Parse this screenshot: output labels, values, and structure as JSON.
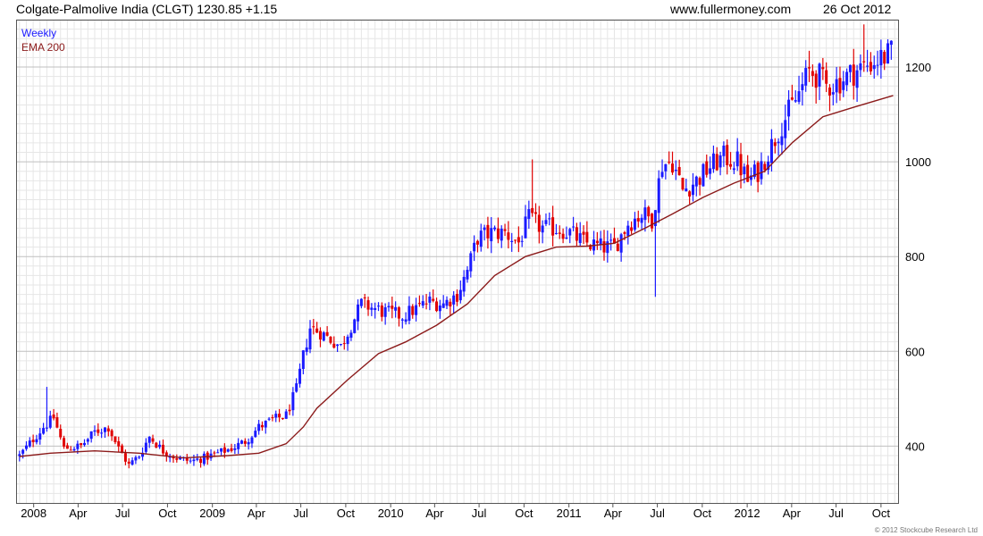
{
  "header": {
    "instrument": "Colgate-Palmolive India (CLGT) 1230.85 +1.15",
    "site": "www.fullermoney.com",
    "date": "26 Oct 2012"
  },
  "copyright": "© 2012 Stockcube Research Ltd",
  "colors": {
    "up": "#1a1aff",
    "down": "#e00000",
    "ema": "#8b1a1a",
    "grid": "#e6e6e6",
    "grid_major": "#bfbfbf",
    "axis": "#555555"
  },
  "chart_data": {
    "type": "candlestick",
    "frequency": "weekly",
    "legend": [
      {
        "label": "Weekly",
        "color": "#1a1aff"
      },
      {
        "label": "EMA 200",
        "color": "#8b1a1a"
      }
    ],
    "legend_position": "top-left",
    "y_axis": {
      "position": "right",
      "range": [
        280,
        1300
      ],
      "ticks": [
        400,
        600,
        800,
        1000,
        1200
      ]
    },
    "x_axis": {
      "range": [
        "2007-11-26",
        "2012-11-05"
      ],
      "ticks": [
        {
          "label": "2008",
          "date": "2008-01-01"
        },
        {
          "label": "Apr",
          "date": "2008-04-01"
        },
        {
          "label": "Jul",
          "date": "2008-07-01"
        },
        {
          "label": "Oct",
          "date": "2008-10-01"
        },
        {
          "label": "2009",
          "date": "2009-01-01"
        },
        {
          "label": "Apr",
          "date": "2009-04-01"
        },
        {
          "label": "Jul",
          "date": "2009-07-01"
        },
        {
          "label": "Oct",
          "date": "2009-10-01"
        },
        {
          "label": "2010",
          "date": "2010-01-01"
        },
        {
          "label": "Apr",
          "date": "2010-04-01"
        },
        {
          "label": "Jul",
          "date": "2010-07-01"
        },
        {
          "label": "Oct",
          "date": "2010-10-01"
        },
        {
          "label": "2011",
          "date": "2011-01-01"
        },
        {
          "label": "Apr",
          "date": "2011-04-01"
        },
        {
          "label": "Jul",
          "date": "2011-07-01"
        },
        {
          "label": "Oct",
          "date": "2011-10-01"
        },
        {
          "label": "2012",
          "date": "2012-01-01"
        },
        {
          "label": "Apr",
          "date": "2012-04-01"
        },
        {
          "label": "Jul",
          "date": "2012-07-01"
        },
        {
          "label": "Oct",
          "date": "2012-10-01"
        }
      ]
    },
    "grid": true,
    "price_path": [
      [
        "2007-12-03",
        380
      ],
      [
        "2008-01-21",
        440
      ],
      [
        "2008-02-11",
        460
      ],
      [
        "2008-03-03",
        395
      ],
      [
        "2008-04-07",
        400
      ],
      [
        "2008-05-05",
        430
      ],
      [
        "2008-06-02",
        440
      ],
      [
        "2008-06-23",
        395
      ],
      [
        "2008-07-14",
        360
      ],
      [
        "2008-08-04",
        380
      ],
      [
        "2008-08-25",
        420
      ],
      [
        "2008-09-22",
        390
      ],
      [
        "2008-10-20",
        375
      ],
      [
        "2008-11-17",
        368
      ],
      [
        "2008-12-15",
        375
      ],
      [
        "2009-01-12",
        385
      ],
      [
        "2009-02-09",
        395
      ],
      [
        "2009-03-09",
        410
      ],
      [
        "2009-04-06",
        440
      ],
      [
        "2009-05-04",
        455
      ],
      [
        "2009-06-01",
        465
      ],
      [
        "2009-06-22",
        520
      ],
      [
        "2009-07-06",
        590
      ],
      [
        "2009-07-20",
        650
      ],
      [
        "2009-08-10",
        640
      ],
      [
        "2009-08-31",
        625
      ],
      [
        "2009-09-21",
        610
      ],
      [
        "2009-10-12",
        655
      ],
      [
        "2009-11-02",
        700
      ],
      [
        "2009-11-30",
        690
      ],
      [
        "2009-12-28",
        680
      ],
      [
        "2010-01-25",
        675
      ],
      [
        "2010-02-22",
        690
      ],
      [
        "2010-03-22",
        705
      ],
      [
        "2010-04-19",
        700
      ],
      [
        "2010-05-17",
        720
      ],
      [
        "2010-06-07",
        770
      ],
      [
        "2010-06-28",
        840
      ],
      [
        "2010-07-26",
        850
      ],
      [
        "2010-08-23",
        850
      ],
      [
        "2010-09-20",
        830
      ],
      [
        "2010-10-11",
        880
      ],
      [
        "2010-11-08",
        860
      ],
      [
        "2010-12-06",
        860
      ],
      [
        "2011-01-03",
        850
      ],
      [
        "2011-01-31",
        830
      ],
      [
        "2011-03-07",
        820
      ],
      [
        "2011-04-04",
        820
      ],
      [
        "2011-05-02",
        870
      ],
      [
        "2011-05-30",
        890
      ],
      [
        "2011-06-20",
        880
      ],
      [
        "2011-07-11",
        995
      ],
      [
        "2011-08-01",
        1000
      ],
      [
        "2011-08-22",
        940
      ],
      [
        "2011-09-19",
        960
      ],
      [
        "2011-10-17",
        990
      ],
      [
        "2011-11-14",
        1010
      ],
      [
        "2011-12-12",
        1000
      ],
      [
        "2012-01-02",
        960
      ],
      [
        "2012-01-23",
        980
      ],
      [
        "2012-02-13",
        1020
      ],
      [
        "2012-03-12",
        1080
      ],
      [
        "2012-04-09",
        1130
      ],
      [
        "2012-05-07",
        1190
      ],
      [
        "2012-05-28",
        1180
      ],
      [
        "2012-06-11",
        1160
      ],
      [
        "2012-07-09",
        1170
      ],
      [
        "2012-08-06",
        1190
      ],
      [
        "2012-09-03",
        1205
      ],
      [
        "2012-09-24",
        1215
      ],
      [
        "2012-10-26",
        1230.85
      ]
    ],
    "ema_200": [
      [
        "2007-12-03",
        378
      ],
      [
        "2008-02-04",
        385
      ],
      [
        "2008-05-05",
        390
      ],
      [
        "2008-08-04",
        385
      ],
      [
        "2008-11-03",
        375
      ],
      [
        "2009-02-02",
        380
      ],
      [
        "2009-04-06",
        385
      ],
      [
        "2009-06-01",
        405
      ],
      [
        "2009-07-06",
        440
      ],
      [
        "2009-08-03",
        480
      ],
      [
        "2009-10-05",
        540
      ],
      [
        "2009-12-07",
        595
      ],
      [
        "2010-02-01",
        620
      ],
      [
        "2010-04-05",
        655
      ],
      [
        "2010-06-07",
        700
      ],
      [
        "2010-08-02",
        760
      ],
      [
        "2010-10-04",
        800
      ],
      [
        "2010-12-06",
        820
      ],
      [
        "2011-02-07",
        822
      ],
      [
        "2011-04-04",
        828
      ],
      [
        "2011-06-06",
        860
      ],
      [
        "2011-08-01",
        890
      ],
      [
        "2011-10-03",
        925
      ],
      [
        "2011-12-05",
        955
      ],
      [
        "2012-02-06",
        980
      ],
      [
        "2012-04-02",
        1040
      ],
      [
        "2012-06-04",
        1095
      ],
      [
        "2012-08-06",
        1115
      ],
      [
        "2012-10-26",
        1140
      ]
    ],
    "extremes": [
      {
        "date": "2011-06-27",
        "low": 715,
        "note": "long lower wick"
      },
      {
        "date": "2010-10-18",
        "high": 1005
      },
      {
        "date": "2012-08-27",
        "high": 1290
      },
      {
        "date": "2008-01-28",
        "high": 525
      }
    ]
  }
}
